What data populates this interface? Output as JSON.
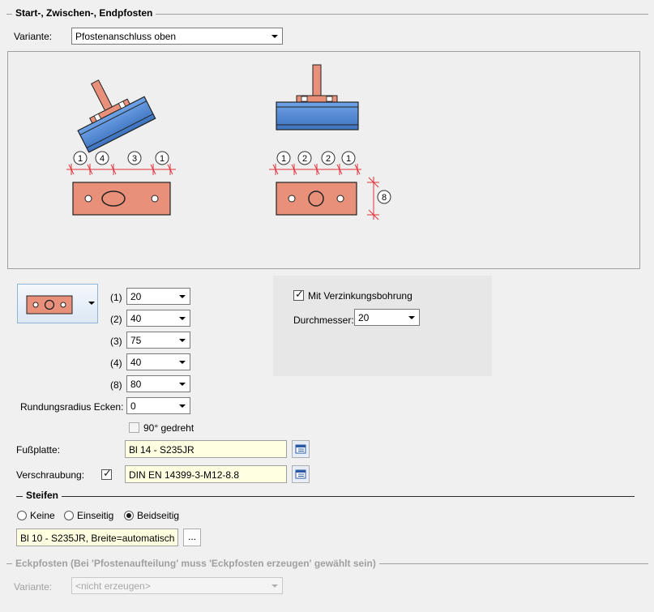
{
  "section1": {
    "title": "Start-, Zwischen-, Endpfosten",
    "variant_label": "Variante:",
    "variant_value": "Pfostenanschluss oben"
  },
  "preview": {
    "left_dims": [
      "1",
      "4",
      "3",
      "1"
    ],
    "right_dims": [
      "1",
      "2",
      "2",
      "1"
    ],
    "side_dim": "8"
  },
  "params": {
    "rows": [
      {
        "label": "(1)",
        "value": "20"
      },
      {
        "label": "(2)",
        "value": "40"
      },
      {
        "label": "(3)",
        "value": "75"
      },
      {
        "label": "(4)",
        "value": "40"
      },
      {
        "label": "(8)",
        "value": "80"
      }
    ],
    "radius_label": "Rundungsradius Ecken:",
    "radius_value": "0",
    "rotated_label": "90° gedreht",
    "galvanizing_label": "Mit Verzinkungsbohrung",
    "diameter_label": "Durchmesser:",
    "diameter_value": "20"
  },
  "footplate": {
    "label": "Fußplatte:",
    "value": "Bl 14 - S235JR"
  },
  "bolting": {
    "label": "Verschraubung:",
    "value": "DIN EN 14399-3-M12-8.8"
  },
  "stiffeners": {
    "title": "Steifen",
    "options": [
      "Keine",
      "Einseitig",
      "Beidseitig"
    ],
    "selected": "Beidseitig",
    "value": "Bl 10 - S235JR, Breite=automatisch",
    "more_button": "..."
  },
  "section2": {
    "title": "Eckpfosten (Bei 'Pfostenaufteilung' muss 'Eckpfosten erzeugen' gewählt sein)",
    "variant_label": "Variante:",
    "variant_value": "<nicht erzeugen>"
  },
  "colors": {
    "plate": "#e8907a",
    "beam": "#5b8fd6",
    "dimension": "#e0303a",
    "field_yellow": "#ffffe1"
  }
}
